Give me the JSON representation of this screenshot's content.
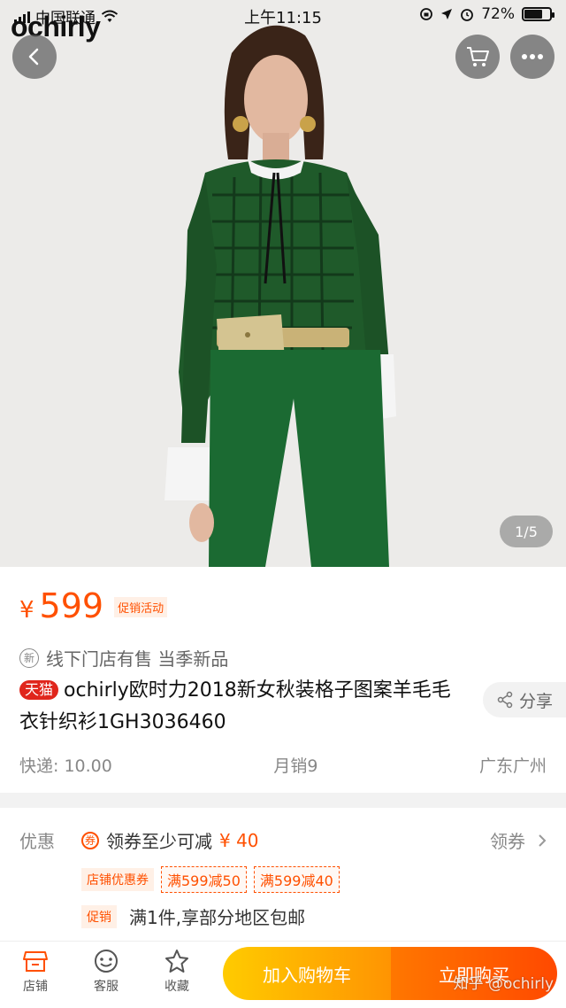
{
  "status_bar": {
    "carrier": "中国联通",
    "time": "上午11:15",
    "battery": "72%",
    "battery_level": 0.72
  },
  "hero": {
    "brand_logo": "ochirly",
    "image_counter": "1/5",
    "buttons": {
      "back_icon": "chevron-left-icon",
      "cart_icon": "cart-icon",
      "more_icon": "more-icon"
    }
  },
  "product": {
    "price_symbol": "¥",
    "price": "599",
    "promo_tag": "促销活动",
    "new_badge": "新",
    "badge_text": "线下门店有售 当季新品",
    "tmall_tag": "天猫",
    "title": "ochirly欧时力2018新女秋装格子图案羊毛毛衣针织衫1GH3036460",
    "share_label": "分享",
    "shipping": "快递: 10.00",
    "monthly_sales": "月销9",
    "location": "广东广州"
  },
  "promotions": {
    "label": "优惠",
    "coupon_icon": "券",
    "coupon_text": "领券至少可减",
    "coupon_amount": "¥ 40",
    "get_coupon": "领券",
    "store_coupon_label": "店铺优惠券",
    "store_coupons": [
      "满599减50",
      "满599减40"
    ],
    "promo_label": "促销",
    "promo_text": "满1件,享部分地区包邮"
  },
  "bottom_bar": {
    "store": "店铺",
    "service": "客服",
    "favorite": "收藏",
    "add_to_cart": "加入购物车",
    "buy_now": "立即购买"
  },
  "watermark": "知乎 @ochirly",
  "colors": {
    "accent": "#ff5000",
    "tmall_red": "#e0261c",
    "cart_button": "#ffa800",
    "buy_button": "#ff5000"
  }
}
